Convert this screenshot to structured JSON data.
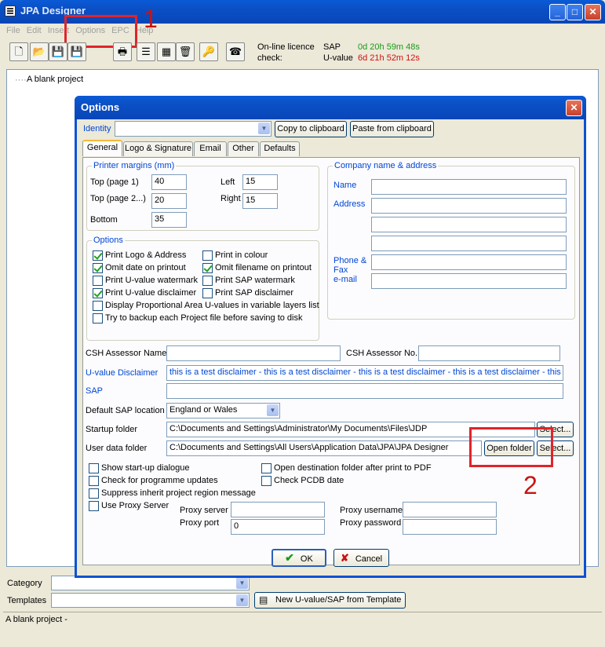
{
  "window": {
    "title": "JPA Designer"
  },
  "menu": [
    "File",
    "Edit",
    "Insert",
    "Options",
    "EPC",
    "Help"
  ],
  "toolbar": {
    "licence_label": "On-line licence",
    "check_label": "check:",
    "sap_label": "SAP",
    "sap_time": "0d 20h 59m 48s",
    "uvalue_label": "U-value",
    "uvalue_time": "6d 21h 52m 12s",
    "sap_color": "#1a9a1a",
    "uvalue_color": "#d01010"
  },
  "tree": {
    "root": "A blank project"
  },
  "bottom": {
    "category_label": "Category",
    "templates_label": "Templates",
    "template_button": "New U-value/SAP from Template",
    "status": "A blank project -"
  },
  "dialog": {
    "title": "Options",
    "identity_label": "Identity",
    "copy_button": "Copy to clipboard",
    "paste_button": "Paste from clipboard",
    "tabs": [
      "General",
      "Logo & Signature",
      "Email",
      "Other",
      "Defaults"
    ],
    "margins": {
      "title": "Printer margins (mm)",
      "top1_label": "Top (page 1)",
      "top1": "40",
      "top2_label": "Top (page 2...)",
      "top2": "20",
      "bottom_label": "Bottom",
      "bottom": "35",
      "left_label": "Left",
      "left": "15",
      "right_label": "Right",
      "right": "15"
    },
    "company": {
      "title": "Company name & address",
      "name_label": "Name",
      "address_label": "Address",
      "phone_label": "Phone &",
      "fax_label": "Fax",
      "email_label": "e-mail"
    },
    "options": {
      "title": "Options",
      "items": [
        {
          "label": "Print Logo & Address",
          "checked": true
        },
        {
          "label": "Print in colour",
          "checked": false
        },
        {
          "label": "Omit date on printout",
          "checked": true
        },
        {
          "label": "Omit filename on printout",
          "checked": true
        },
        {
          "label": "Print U-value watermark",
          "checked": false
        },
        {
          "label": "Print SAP watermark",
          "checked": false
        },
        {
          "label": "Print U-value disclaimer",
          "checked": true
        },
        {
          "label": "Print SAP disclaimer",
          "checked": false
        },
        {
          "label": "Display Proportional Area U-values in variable layers list",
          "checked": false
        },
        {
          "label": "Try to backup each Project file before saving to disk",
          "checked": false
        }
      ]
    },
    "csh_name_label": "CSH Assessor Name",
    "csh_no_label": "CSH Assessor No.",
    "uvalue_disclaimer_label": "U-value Disclaimer",
    "uvalue_disclaimer": "this is a test disclaimer - this is a test disclaimer - this is a test disclaimer - this is a test disclaimer - this is a te",
    "sap_label": "SAP",
    "default_sap_label": "Default SAP location",
    "default_sap": "England or Wales",
    "startup_label": "Startup folder",
    "startup_path": "C:\\Documents and Settings\\Administrator\\My Documents\\Files\\JDP",
    "userdata_label": "User data folder",
    "userdata_path": "C:\\Documents and Settings\\All Users\\Application Data\\JPA\\JPA Designer",
    "select_button": "Select...",
    "open_folder_button": "Open folder",
    "checks": [
      {
        "label": "Show start-up dialogue",
        "checked": false
      },
      {
        "label": "Open destination folder after print to PDF",
        "checked": false
      },
      {
        "label": "Check for programme updates",
        "checked": false
      },
      {
        "label": "Check PCDB date",
        "checked": false
      },
      {
        "label": "Suppress inherit project region message",
        "checked": false
      },
      {
        "label": "Use Proxy Server",
        "checked": false
      }
    ],
    "proxy_server_label": "Proxy server",
    "proxy_port_label": "Proxy port",
    "proxy_port": "0",
    "proxy_user_label": "Proxy username",
    "proxy_pass_label": "Proxy password",
    "ok_button": "OK",
    "cancel_button": "Cancel"
  },
  "annotations": {
    "one": "1",
    "two": "2"
  }
}
